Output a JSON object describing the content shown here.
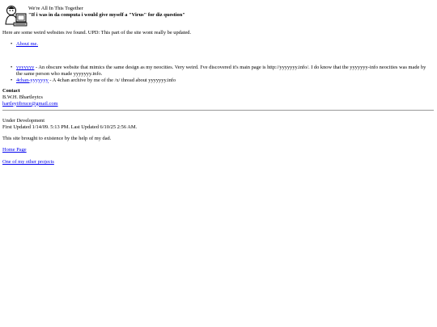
{
  "header": {
    "logo_icon": "computer-and-person-logo-icon",
    "tagline": "We're All In This Together",
    "quote": "\"If i was in da computa i would give myself a \"Virus\" for diz question\""
  },
  "intro": "Here are some weird websites ive found. UPD: This part of the site wont really be updated.",
  "list1": [
    {
      "link": "About me."
    }
  ],
  "list2": [
    {
      "link": "yyyyyyy",
      "text": " - An obscure website that mimics the same design as my neocities. Very weird. I've discovered it's main page is http://yyyyyyy.info/. I do know that the yyyyyyy-info neocities was made by the same person who made yyyyyyy.info."
    },
    {
      "link": "4chan-yyyyyyy",
      "text": " - A 4chan archive by me of the /x/ thread about yyyyyyy.info"
    }
  ],
  "contact": {
    "heading": "Contact",
    "name": "B.W.H. Bhartleytcs",
    "email": "hartleyiibruce@gmail.com"
  },
  "status": {
    "line1": "Under Development",
    "line2": "First Updated 1/14/09. 5:13 PM. Last Updated 6/10/25 2:56 AM."
  },
  "credit": "This site brought to existence by the help of my dad.",
  "links": {
    "home": "Home Page",
    "other": "One of my other projects"
  }
}
